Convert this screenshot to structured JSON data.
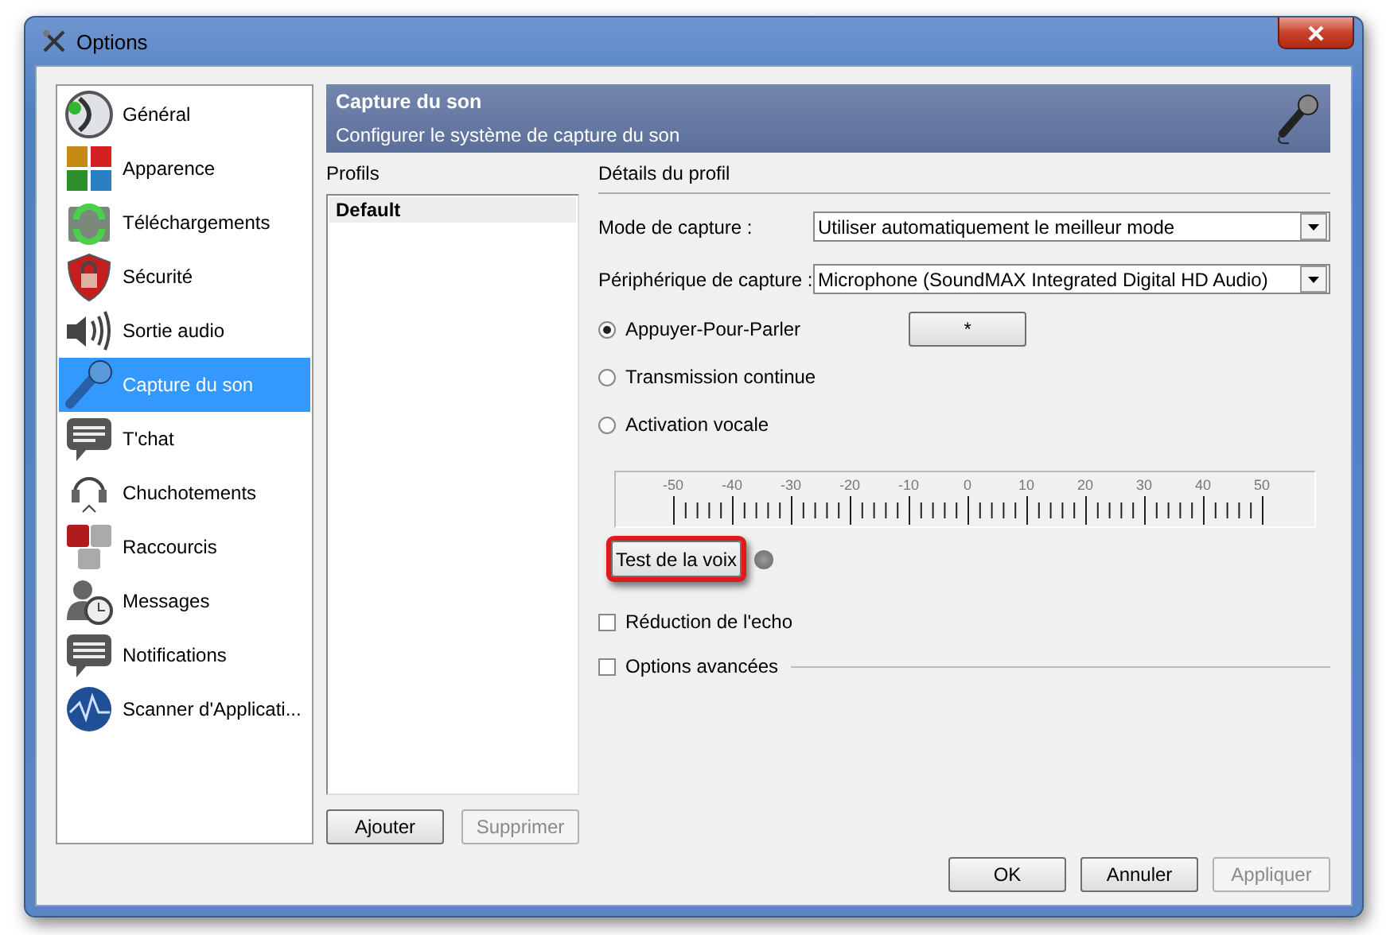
{
  "window": {
    "title": "Options"
  },
  "sidebar": {
    "items": [
      {
        "label": "Général",
        "selected": false
      },
      {
        "label": "Apparence",
        "selected": false
      },
      {
        "label": "Téléchargements",
        "selected": false
      },
      {
        "label": "Sécurité",
        "selected": false
      },
      {
        "label": "Sortie audio",
        "selected": false
      },
      {
        "label": "Capture du son",
        "selected": true
      },
      {
        "label": "T'chat",
        "selected": false
      },
      {
        "label": "Chuchotements",
        "selected": false
      },
      {
        "label": "Raccourcis",
        "selected": false
      },
      {
        "label": "Messages",
        "selected": false
      },
      {
        "label": "Notifications",
        "selected": false
      },
      {
        "label": "Scanner d'Applicati...",
        "selected": false
      }
    ]
  },
  "header": {
    "title": "Capture du son",
    "subtitle": "Configurer le système de capture du son"
  },
  "profiles": {
    "label": "Profils",
    "items": [
      {
        "label": "Default",
        "selected": true
      }
    ],
    "buttons": [
      {
        "label": "Ajouter",
        "disabled": false
      },
      {
        "label": "Supprimer",
        "disabled": true
      }
    ]
  },
  "details": {
    "title": "Détails du profil",
    "dropdowns": [
      {
        "label": "Mode de capture  :",
        "value": "Utiliser automatiquement le meilleur mode"
      },
      {
        "label": "Périphérique de capture :",
        "value": "Microphone (SoundMAX Integrated Digital HD Audio)"
      }
    ],
    "modes": [
      {
        "label": "Appuyer-Pour-Parler",
        "selected": true,
        "hotkey": "*"
      },
      {
        "label": "Transmission continue",
        "selected": false
      },
      {
        "label": "Activation vocale",
        "selected": false
      }
    ],
    "scale_labels": [
      "-50",
      "-40",
      "-30",
      "-20",
      "-10",
      "0",
      "10",
      "20",
      "30",
      "40",
      "50"
    ],
    "test_button": {
      "label": "Test de la voix",
      "highlighted": true
    },
    "checkboxes": [
      {
        "label": "Réduction de l'echo",
        "checked": false,
        "kind": "plain"
      },
      {
        "label": "Options avancées",
        "checked": false,
        "kind": "group"
      }
    ]
  },
  "buttons": [
    {
      "label": "OK",
      "disabled": false
    },
    {
      "label": "Annuler",
      "disabled": false
    },
    {
      "label": "Appliquer",
      "disabled": true
    }
  ]
}
